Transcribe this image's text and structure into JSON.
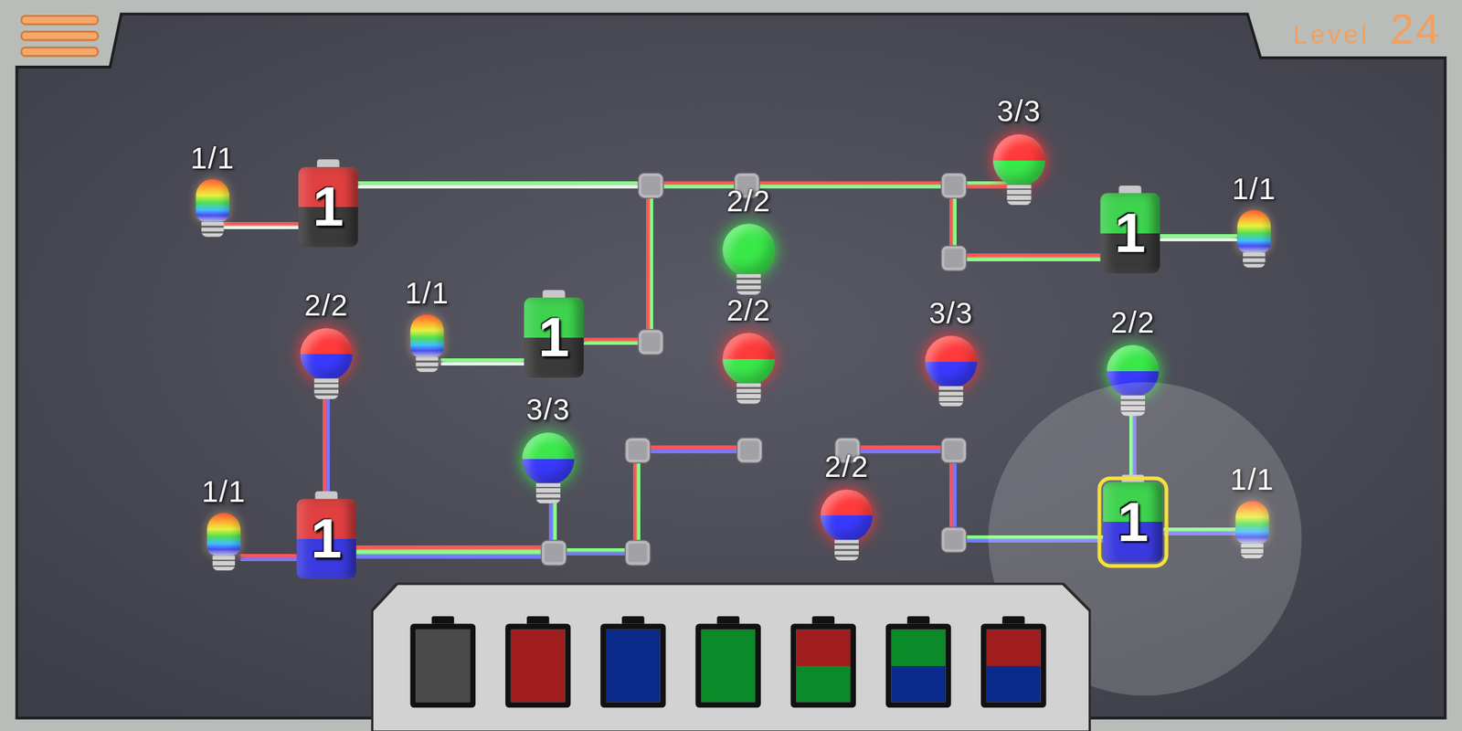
{
  "level": {
    "label": "Level",
    "number": "24"
  },
  "batteries": [
    {
      "value": "1",
      "top": "#e04040",
      "bottom": "#3a3a3a",
      "selected": false
    },
    {
      "value": "1",
      "top": "#3fd24f",
      "bottom": "#3a3a3a",
      "selected": false
    },
    {
      "value": "1",
      "top": "#3fd24f",
      "bottom": "#3a3a3a",
      "selected": false
    },
    {
      "value": "1",
      "top": "#e04040",
      "bottom": "#3a3ae0",
      "selected": false
    },
    {
      "value": "1",
      "top": "#3fd24f",
      "bottom": "#3a3ae0",
      "selected": true
    }
  ],
  "bulbs": [
    {
      "label": "1/1",
      "kind": "rainbow",
      "colors": []
    },
    {
      "label": "1/1",
      "kind": "rainbow",
      "colors": []
    },
    {
      "label": "1/1",
      "kind": "rainbow",
      "colors": []
    },
    {
      "label": "1/1",
      "kind": "rainbow",
      "colors": []
    },
    {
      "label": "1/1",
      "kind": "rainbow",
      "colors": []
    },
    {
      "label": "2/2",
      "kind": "color",
      "colors": [
        "#ff3a3a",
        "#3a3aff"
      ]
    },
    {
      "label": "2/2",
      "kind": "color",
      "colors": [
        "#3ae84a"
      ]
    },
    {
      "label": "2/2",
      "kind": "color",
      "colors": [
        "#ff3a3a",
        "#3ae84a"
      ]
    },
    {
      "label": "3/3",
      "kind": "color",
      "colors": [
        "#3ae84a",
        "#3a3aff"
      ]
    },
    {
      "label": "3/3",
      "kind": "color",
      "colors": [
        "#ff3a3a",
        "#3ae84a"
      ]
    },
    {
      "label": "3/3",
      "kind": "color",
      "colors": [
        "#ff3a3a",
        "#3a3aff"
      ]
    },
    {
      "label": "2/2",
      "kind": "color",
      "colors": [
        "#3ae84a",
        "#3a3aff"
      ]
    },
    {
      "label": "2/2",
      "kind": "color",
      "colors": [
        "#ff3a3a",
        "#3a3aff"
      ]
    }
  ],
  "wires": [
    {
      "colors": [
        "#ff5555",
        "#e6f5e6"
      ]
    },
    {
      "colors": [
        "#88ff88",
        "#e6f5e6"
      ]
    },
    {
      "colors": [
        "#ff5555",
        "#88ff88"
      ]
    },
    {
      "colors": [
        "#ff5555",
        "#88ff88"
      ]
    },
    {
      "colors": [
        "#88ff88",
        "#ff5555"
      ]
    },
    {
      "colors": [
        "#ff5555",
        "#88ff88"
      ]
    },
    {
      "colors": [
        "#ff5555",
        "#88ff88"
      ]
    },
    {
      "colors": [
        "#ff5555"
      ]
    },
    {
      "colors": [
        "#ff5555",
        "#7777ff"
      ]
    },
    {
      "colors": [
        "#ff5555",
        "#7777ff"
      ]
    },
    {
      "colors": [
        "#ff5555",
        "#88ff88",
        "#7777ff"
      ]
    },
    {
      "colors": [
        "#88ff88",
        "#7777ff"
      ]
    },
    {
      "colors": [
        "#7777ff",
        "#88ff88"
      ]
    },
    {
      "colors": [
        "#88ff88"
      ]
    },
    {
      "colors": [
        "#88ff88",
        "#e6f5e6"
      ]
    },
    {
      "colors": [
        "#ff5555",
        "#88ff88"
      ]
    },
    {
      "colors": [
        "#ff5555",
        "#7777ff"
      ]
    },
    {
      "colors": [
        "#7777ff"
      ]
    },
    {
      "colors": [
        "#ff5555"
      ]
    },
    {
      "colors": [
        "#ff5555",
        "#7777ff"
      ]
    },
    {
      "colors": [
        "#ff5555"
      ]
    },
    {
      "colors": [
        "#ff5555",
        "#88ff88"
      ]
    },
    {
      "colors": [
        "#ff5555",
        "#88ff88"
      ]
    },
    {
      "colors": [
        "#ff5555"
      ]
    },
    {
      "colors": [
        "#7777ff"
      ]
    },
    {
      "colors": [
        "#ff5555",
        "#7777ff"
      ]
    },
    {
      "colors": [
        "#88ff88",
        "#7777ff"
      ]
    },
    {
      "colors": [
        "#88ff88",
        "#e6f5e6"
      ]
    },
    {
      "colors": [
        "#88ff88"
      ]
    },
    {
      "colors": [
        "#88ff88",
        "#7777ff"
      ]
    },
    {
      "colors": [
        "#88ff88",
        "#7777ff"
      ]
    }
  ],
  "palette": [
    {
      "top": "#4a4a4a",
      "bottom": "#4a4a4a"
    },
    {
      "top": "#a01e1e",
      "bottom": "#a01e1e"
    },
    {
      "top": "#0a2a8c",
      "bottom": "#0a2a8c"
    },
    {
      "top": "#0a8a28",
      "bottom": "#0a8a28"
    },
    {
      "top": "#a01e1e",
      "bottom": "#0a8a28"
    },
    {
      "top": "#0a8a28",
      "bottom": "#0a2a8c"
    },
    {
      "top": "#a01e1e",
      "bottom": "#0a2a8c"
    }
  ]
}
